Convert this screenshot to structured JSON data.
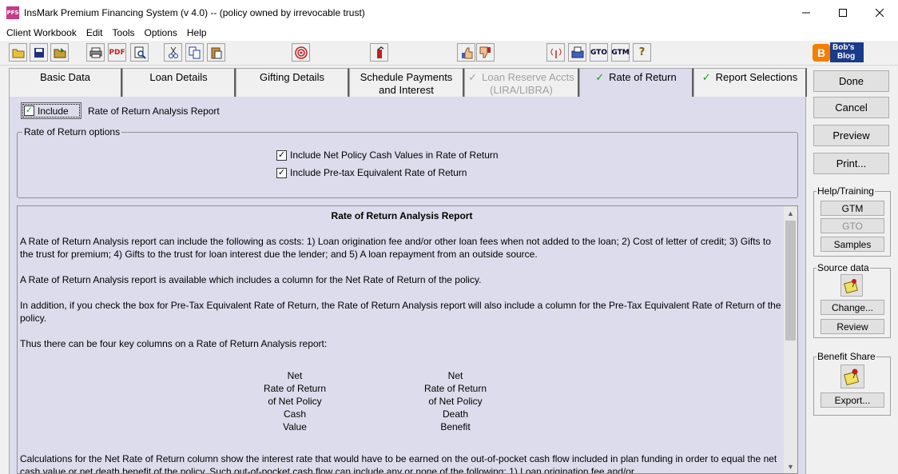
{
  "window": {
    "title": "InsMark Premium Financing System (v 4.0) --  (policy owned by irrevocable trust)",
    "icon_text": "PFS"
  },
  "menu": [
    "Client Workbook",
    "Edit",
    "Tools",
    "Options",
    "Help"
  ],
  "toolbar": {
    "pdf_label": "PDF",
    "gto_label": "GTO",
    "gtm_label": "GTM",
    "help_label": "?",
    "blog_line1": "Bob's",
    "blog_line2": "Blog"
  },
  "tabs": [
    {
      "line1": "Basic Data",
      "line2": ""
    },
    {
      "line1": "Loan Details",
      "line2": ""
    },
    {
      "line1": "Gifting Details",
      "line2": ""
    },
    {
      "line1": "Schedule Payments",
      "line2": "and Interest"
    },
    {
      "line1": "Loan Reserve Accts",
      "line2": "(LIRA/LIBRA)"
    },
    {
      "line1": "Rate of Return",
      "line2": ""
    },
    {
      "line1": "Report Selections",
      "line2": ""
    }
  ],
  "include": {
    "button_label": "Include",
    "report_label": "Rate of Return Analysis Report"
  },
  "options": {
    "legend": "Rate of Return options",
    "opt1": "Include Net Policy Cash Values in Rate of Return",
    "opt2": "Include Pre-tax Equivalent Rate of Return"
  },
  "report": {
    "title": "Rate of Return Analysis Report",
    "p1": "A Rate of Return Analysis report can include the following as costs:  1) Loan origination fee and/or other loan fees when not added to the loan; 2) Cost of letter of credit; 3) Gifts to the trust for premium; 4) Gifts to the trust for loan interest due the lender; and 5) A loan repayment from an outside source.",
    "p2": "A Rate of Return Analysis report is available which includes a column for the Net Rate of Return of the policy.",
    "p3": "In addition, if you check the box for Pre-Tax Equivalent Rate of Return, the Rate of Return Analysis report will also include a column for the Pre-Tax Equivalent Rate of Return of the policy.",
    "p4": "Thus there can be four key columns on a Rate of Return Analysis report:",
    "col1": [
      "Net",
      "Rate of Return",
      "of Net Policy",
      "Cash",
      "Value"
    ],
    "col2": [
      "Net",
      "Rate of Return",
      "of Net Policy",
      "Death",
      "Benefit"
    ],
    "p5": "Calculations for the Net Rate of Return column show the interest rate that would have to be earned on the out-of-pocket cash flow included in plan funding in order to equal the net cash value or net death benefit of the policy. Such out-of-pocket cash flow can include any or none of the following: 1) Loan origination fee and/or"
  },
  "right": {
    "done": "Done",
    "cancel": "Cancel",
    "preview": "Preview",
    "print": "Print...",
    "help_legend": "Help/Training",
    "gtm": "GTM",
    "gto": "GTO",
    "samples": "Samples",
    "source_legend": "Source data",
    "change": "Change...",
    "review": "Review",
    "benefit_legend": "Benefit Share",
    "export": "Export..."
  }
}
